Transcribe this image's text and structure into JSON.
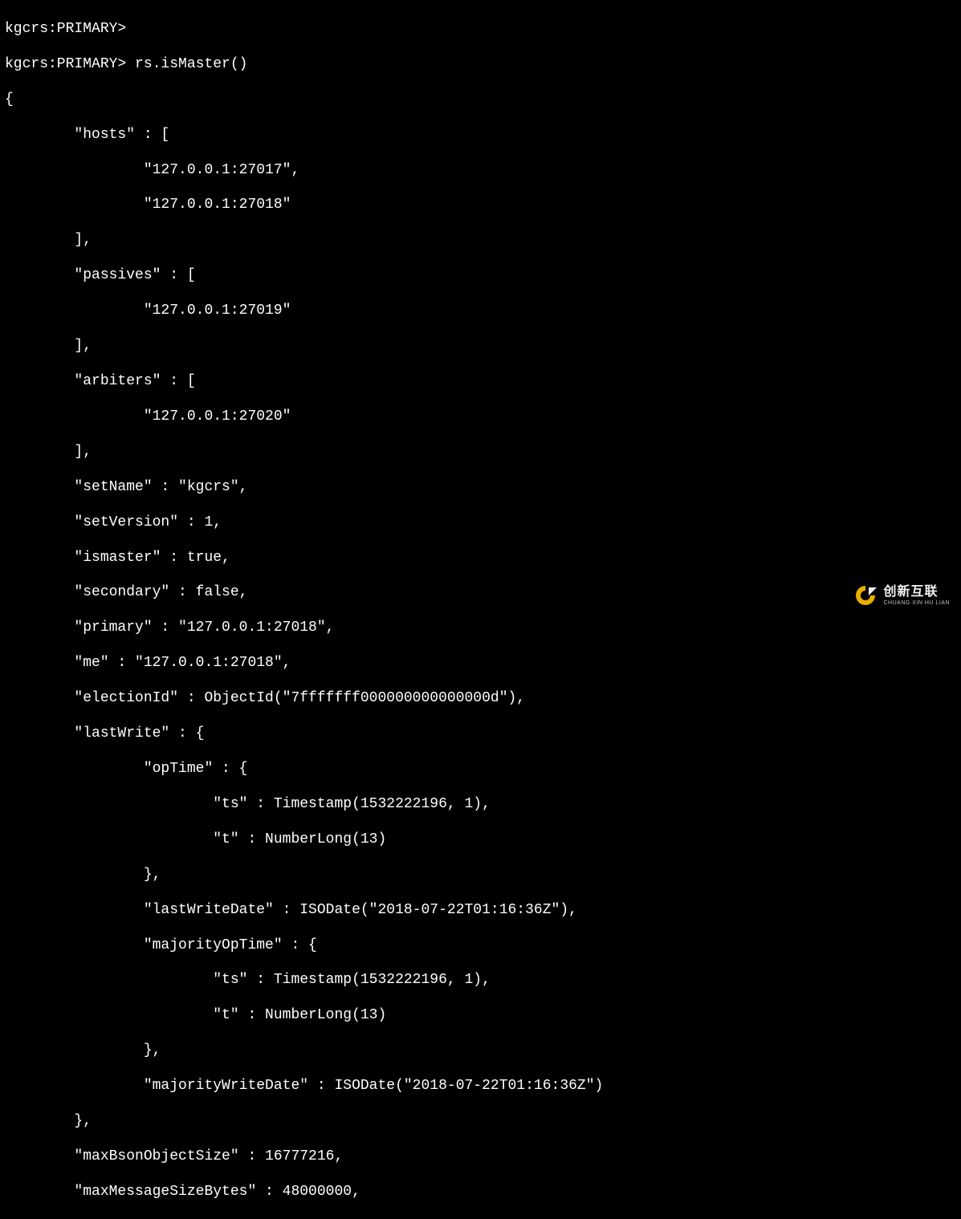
{
  "terminal": {
    "prompt": "kgcrs:PRIMARY>",
    "command": "rs.isMaster()",
    "output": {
      "hosts": [
        "127.0.0.1:27017",
        "127.0.0.1:27018"
      ],
      "passives": [
        "127.0.0.1:27019"
      ],
      "arbiters": [
        "127.0.0.1:27020"
      ],
      "setName": "kgcrs",
      "setVersion": 1,
      "ismaster": true,
      "secondary": false,
      "primary": "127.0.0.1:27018",
      "me": "127.0.0.1:27018",
      "electionId": "ObjectId(\"7fffffff000000000000000d\")",
      "lastWrite": {
        "opTime": {
          "ts": "Timestamp(1532222196, 1)",
          "t": "NumberLong(13)"
        },
        "lastWriteDate": "ISODate(\"2018-07-22T01:16:36Z\")",
        "majorityOpTime": {
          "ts": "Timestamp(1532222196, 1)",
          "t": "NumberLong(13)"
        },
        "majorityWriteDate": "ISODate(\"2018-07-22T01:16:36Z\")"
      },
      "maxBsonObjectSize": 16777216,
      "maxMessageSizeBytes": 48000000
    }
  },
  "lines": {
    "l01": "kgcrs:PRIMARY>",
    "l02": "kgcrs:PRIMARY> rs.isMaster()",
    "l03": "{",
    "l04": "        \"hosts\" : [",
    "l05": "                \"127.0.0.1:27017\",",
    "l06": "                \"127.0.0.1:27018\"",
    "l07": "        ],",
    "l08": "        \"passives\" : [",
    "l09": "                \"127.0.0.1:27019\"",
    "l10": "        ],",
    "l11": "        \"arbiters\" : [",
    "l12": "                \"127.0.0.1:27020\"",
    "l13": "        ],",
    "l14": "        \"setName\" : \"kgcrs\",",
    "l15": "        \"setVersion\" : 1,",
    "l16": "        \"ismaster\" : true,",
    "l17": "        \"secondary\" : false,",
    "l18": "        \"primary\" : \"127.0.0.1:27018\",",
    "l19": "        \"me\" : \"127.0.0.1:27018\",",
    "l20": "        \"electionId\" : ObjectId(\"7fffffff000000000000000d\"),",
    "l21": "        \"lastWrite\" : {",
    "l22": "                \"opTime\" : {",
    "l23": "                        \"ts\" : Timestamp(1532222196, 1),",
    "l24": "                        \"t\" : NumberLong(13)",
    "l25": "                },",
    "l26": "                \"lastWriteDate\" : ISODate(\"2018-07-22T01:16:36Z\"),",
    "l27": "                \"majorityOpTime\" : {",
    "l28": "                        \"ts\" : Timestamp(1532222196, 1),",
    "l29": "                        \"t\" : NumberLong(13)",
    "l30": "                },",
    "l31": "                \"majorityWriteDate\" : ISODate(\"2018-07-22T01:16:36Z\")",
    "l32": "        },",
    "l33": "        \"maxBsonObjectSize\" : 16777216,",
    "l34": "        \"maxMessageSizeBytes\" : 48000000,"
  },
  "watermark": {
    "cn": "创新互联",
    "en": "CHUANG XIN HU LIAN"
  }
}
